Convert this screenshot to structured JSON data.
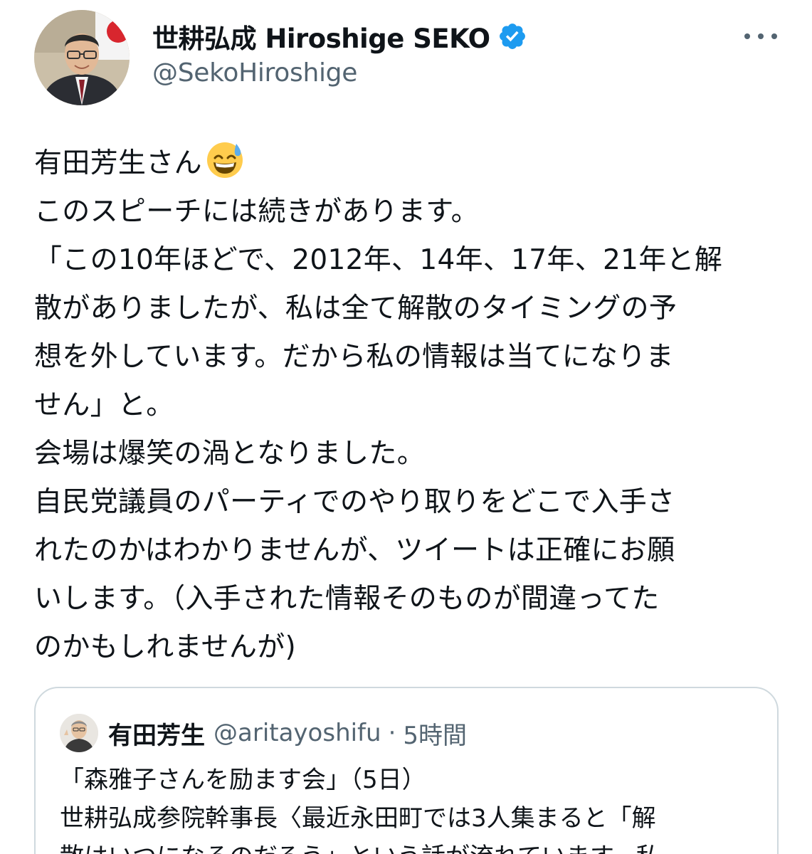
{
  "author": {
    "name": "世耕弘成 Hiroshige SEKO",
    "handle": "@SekoHiroshige",
    "verified_icon": "verified-badge",
    "verified_color": "#1d9bf0"
  },
  "more_icon": "more-horizontal-icon",
  "tweet": {
    "lines": [
      "有田芳生さん",
      "このスピーチには続きがあります。",
      "「この10年ほどで、2012年、14年、17年、21年と解",
      "散がありましたが、私は全て解散のタイミングの予",
      "想を外しています。だから私の情報は当てになりま",
      "せん」と。",
      "会場は爆笑の渦となりました。",
      "自民党議員のパーティでのやり取りをどこで入手さ",
      "れたのかはわかりませんが、ツイートは正確にお願",
      "いします。（入手された情報そのものが間違ってた",
      "のかもしれませんが)"
    ],
    "emoji": "grinning-face-with-sweat"
  },
  "quote": {
    "name": "有田芳生",
    "handle": "@aritayoshifu",
    "separator": "·",
    "time": "5時間",
    "lines": [
      "「森雅子さんを励ます会」（5日）",
      "世耕弘成参院幹事長〈最近永田町では3人集まると「解",
      "散はいつになるのだろう」という話が流れています。私"
    ]
  },
  "colors": {
    "text": "#0f1419",
    "secondary": "#536471",
    "border": "#cfd9de",
    "accent": "#1d9bf0"
  }
}
